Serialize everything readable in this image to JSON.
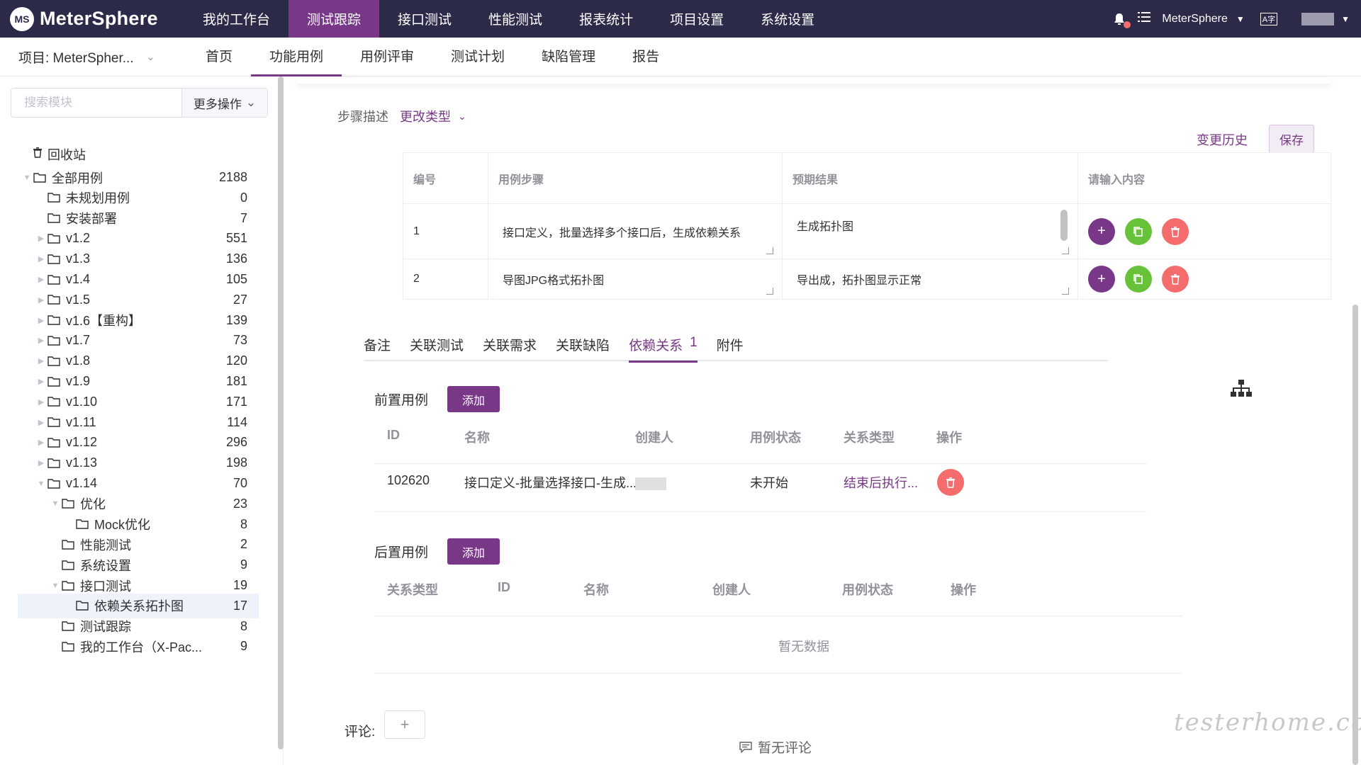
{
  "brand": {
    "logo_text": "MeterSphere",
    "logo_mark": "MS"
  },
  "top_menu": [
    {
      "label": "我的工作台",
      "active": false
    },
    {
      "label": "测试跟踪",
      "active": true
    },
    {
      "label": "接口测试",
      "active": false
    },
    {
      "label": "性能测试",
      "active": false
    },
    {
      "label": "报表统计",
      "active": false
    },
    {
      "label": "项目设置",
      "active": false
    },
    {
      "label": "系统设置",
      "active": false
    }
  ],
  "top_right": {
    "workspace": "MeterSphere",
    "lang_icon": "language-icon"
  },
  "project": {
    "label": "项目: MeterSpher..."
  },
  "sub_tabs": [
    {
      "label": "首页",
      "active": false
    },
    {
      "label": "功能用例",
      "active": true
    },
    {
      "label": "用例评审",
      "active": false
    },
    {
      "label": "测试计划",
      "active": false
    },
    {
      "label": "缺陷管理",
      "active": false
    },
    {
      "label": "报告",
      "active": false
    }
  ],
  "sidebar": {
    "search_placeholder": "搜索模块",
    "more_ops": "更多操作",
    "recycle": "回收站",
    "tree": [
      {
        "label": "全部用例",
        "count": "2188",
        "level": 0,
        "arrow": "down"
      },
      {
        "label": "未规划用例",
        "count": "0",
        "level": 1,
        "arrow": ""
      },
      {
        "label": "安装部署",
        "count": "7",
        "level": 1,
        "arrow": ""
      },
      {
        "label": "v1.2",
        "count": "551",
        "level": 1,
        "arrow": "right"
      },
      {
        "label": "v1.3",
        "count": "136",
        "level": 1,
        "arrow": "right"
      },
      {
        "label": "v1.4",
        "count": "105",
        "level": 1,
        "arrow": "right"
      },
      {
        "label": "v1.5",
        "count": "27",
        "level": 1,
        "arrow": "right"
      },
      {
        "label": "v1.6【重构】",
        "count": "139",
        "level": 1,
        "arrow": "right"
      },
      {
        "label": "v1.7",
        "count": "73",
        "level": 1,
        "arrow": "right"
      },
      {
        "label": "v1.8",
        "count": "120",
        "level": 1,
        "arrow": "right"
      },
      {
        "label": "v1.9",
        "count": "181",
        "level": 1,
        "arrow": "right"
      },
      {
        "label": "v1.10",
        "count": "171",
        "level": 1,
        "arrow": "right"
      },
      {
        "label": "v1.11",
        "count": "114",
        "level": 1,
        "arrow": "right"
      },
      {
        "label": "v1.12",
        "count": "296",
        "level": 1,
        "arrow": "right"
      },
      {
        "label": "v1.13",
        "count": "198",
        "level": 1,
        "arrow": "right"
      },
      {
        "label": "v1.14",
        "count": "70",
        "level": 1,
        "arrow": "down"
      },
      {
        "label": "优化",
        "count": "23",
        "level": 2,
        "arrow": "down"
      },
      {
        "label": "Mock优化",
        "count": "8",
        "level": 3,
        "arrow": ""
      },
      {
        "label": "性能测试",
        "count": "2",
        "level": 2,
        "arrow": ""
      },
      {
        "label": "系统设置",
        "count": "9",
        "level": 2,
        "arrow": ""
      },
      {
        "label": "接口测试",
        "count": "19",
        "level": 2,
        "arrow": "down"
      },
      {
        "label": "依赖关系拓扑图",
        "count": "17",
        "level": 3,
        "arrow": "",
        "selected": true
      },
      {
        "label": "测试跟踪",
        "count": "8",
        "level": 2,
        "arrow": ""
      },
      {
        "label": "我的工作台（X-Pac...",
        "count": "9",
        "level": 2,
        "arrow": ""
      }
    ]
  },
  "steps": {
    "label": "步骤描述",
    "change_type": "更改类型",
    "history": "变更历史",
    "save": "保存",
    "headers": [
      "编号",
      "用例步骤",
      "预期结果",
      "请输入内容"
    ],
    "rows": [
      {
        "num": "1",
        "step": "接口定义，批量选择多个接口后，生成依赖关系",
        "result": "生成拓扑图"
      },
      {
        "num": "2",
        "step": "导图JPG格式拓扑图",
        "result": "导出成，拓扑图显示正常"
      }
    ]
  },
  "detail_tabs": [
    {
      "label": "备注",
      "active": false,
      "badge": ""
    },
    {
      "label": "关联测试",
      "active": false,
      "badge": ""
    },
    {
      "label": "关联需求",
      "active": false,
      "badge": ""
    },
    {
      "label": "关联缺陷",
      "active": false,
      "badge": ""
    },
    {
      "label": "依赖关系",
      "active": true,
      "badge": "1"
    },
    {
      "label": "附件",
      "active": false,
      "badge": ""
    }
  ],
  "pre_cases": {
    "title": "前置用例",
    "add": "添加",
    "headers": [
      "ID",
      "名称",
      "创建人",
      "用例状态",
      "关系类型",
      "操作"
    ],
    "rows": [
      {
        "id": "102620",
        "name": "接口定义-批量选择接口-生成...",
        "creator": "",
        "status": "未开始",
        "relation": "结束后执行..."
      }
    ]
  },
  "post_cases": {
    "title": "后置用例",
    "add": "添加",
    "headers": [
      "关系类型",
      "ID",
      "名称",
      "创建人",
      "用例状态",
      "操作"
    ],
    "empty": "暂无数据"
  },
  "comments": {
    "label": "评论:",
    "add": "+",
    "empty": "暂无评论"
  },
  "watermark": "testerhome.com",
  "colors": {
    "nav_bg": "#2c2a49",
    "accent": "#783887",
    "success": "#67c23a",
    "danger": "#f56c6c"
  }
}
